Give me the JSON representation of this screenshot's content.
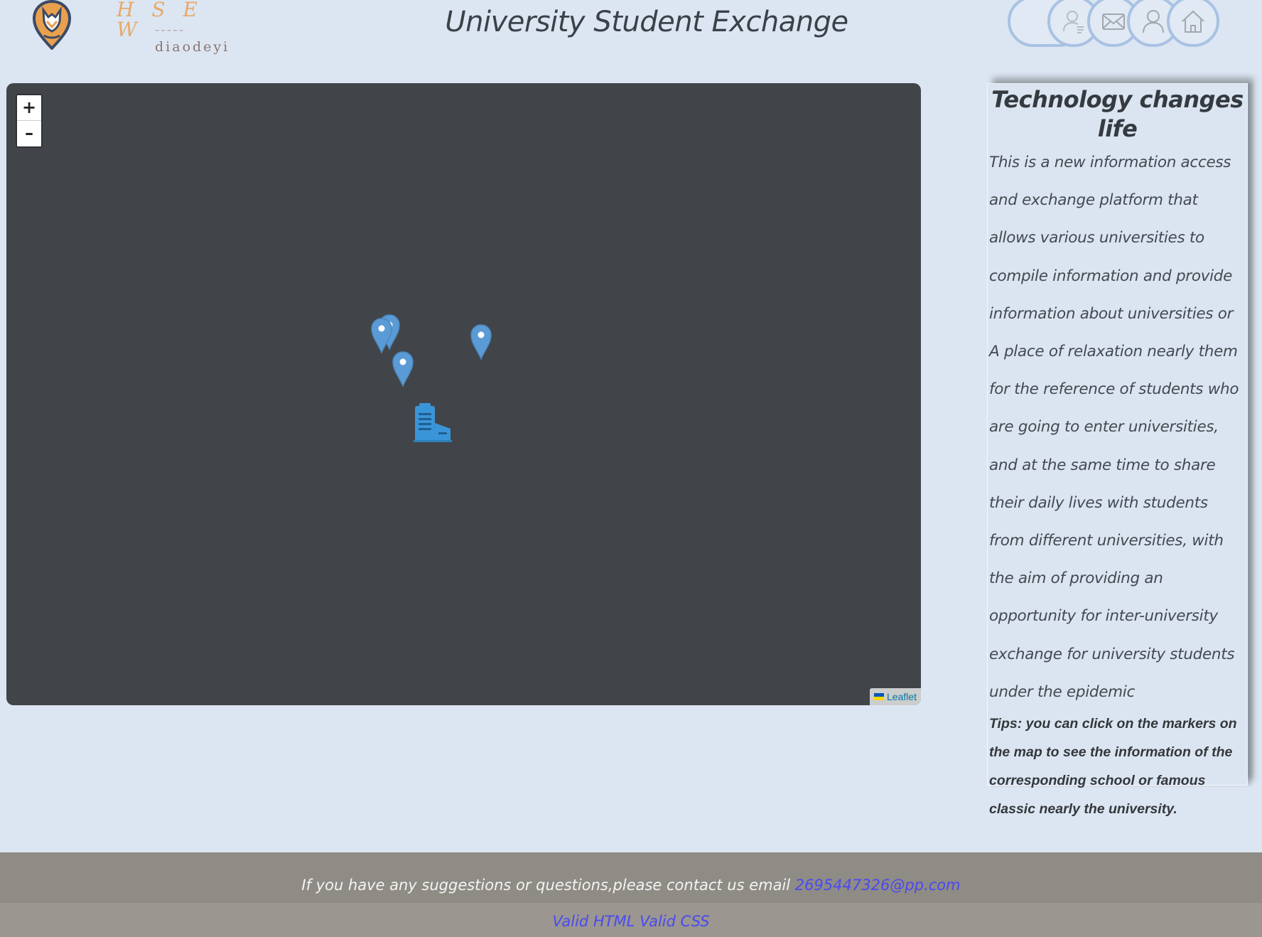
{
  "header": {
    "logo_text": "H S E W",
    "logo_dashes": "-----",
    "logo_sub": "diaodeyi",
    "title": "University Student Exchange",
    "nav_icons": [
      "nav-blank-icon",
      "user-badge-icon",
      "mail-icon",
      "user-icon",
      "home-icon"
    ]
  },
  "map": {
    "zoom_in": "+",
    "zoom_out": "–",
    "attribution": "Leaflet",
    "markers": [
      "marker-1",
      "marker-2",
      "marker-3",
      "marker-4"
    ],
    "colors": {
      "background": "#414549",
      "marker": "#5b9bd5"
    }
  },
  "aside": {
    "title": "Technology changes life",
    "body": "This is a new information access and exchange platform that allows various universities to compile information and provide information about universities or A place of relaxation nearly them for the reference of students who are going to enter universities, and at the same time to share their daily lives with students from different universities, with the aim of providing an opportunity for inter-university exchange for university students under the epidemic",
    "tips": "Tips: you can click on the markers on the map to see the information of the corresponding school or famous classic nearly the university."
  },
  "footer": {
    "contact_text": "If you have any suggestions or questions,please contact us email ",
    "email": "2695447326@pp.com",
    "valid_html": "Valid HTML",
    "valid_css": "Valid CSS"
  }
}
